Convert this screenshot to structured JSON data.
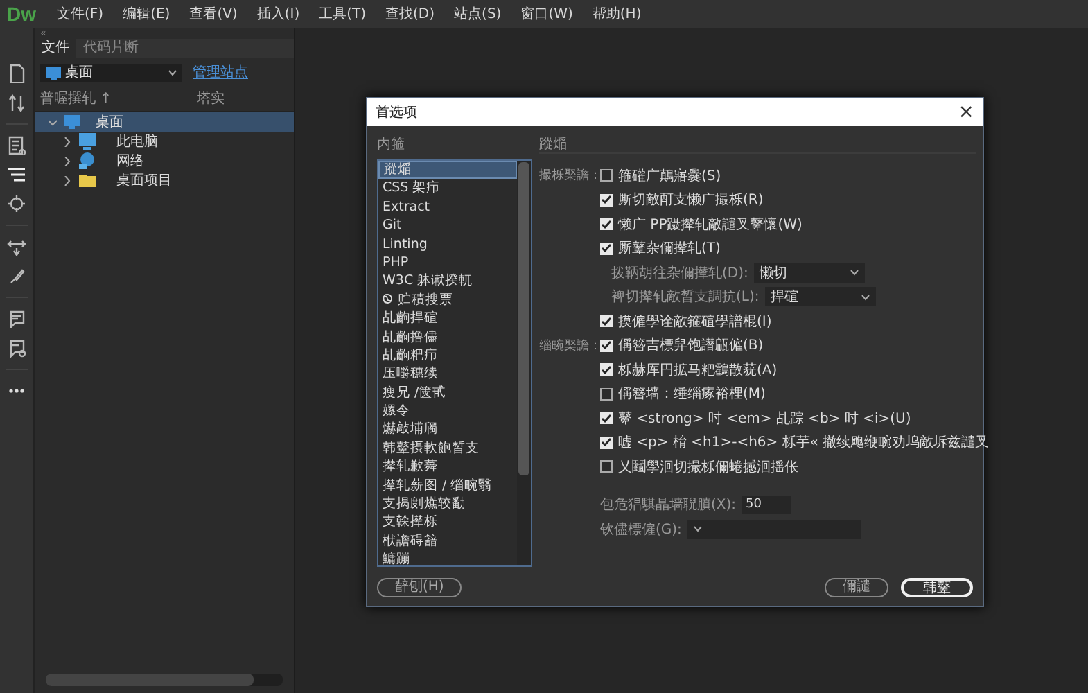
{
  "app": {
    "logo": "Dw"
  },
  "menu": [
    "文件(F)",
    "编辑(E)",
    "查看(V)",
    "插入(I)",
    "工具(T)",
    "查找(D)",
    "站点(S)",
    "窗口(W)",
    "帮助(H)"
  ],
  "panel": {
    "collapse": "«",
    "tabs": [
      {
        "label": "文件",
        "selected": true
      },
      {
        "label": "代码片断",
        "selected": false
      }
    ],
    "site": "桌面",
    "manage_link": "管理站点",
    "columns": [
      "普喔撰轧 ↑",
      "塔实"
    ],
    "tree": [
      {
        "label": "桌面",
        "kind": "monitor",
        "expanded": true,
        "selected": true,
        "children": [
          {
            "label": "此电脑",
            "kind": "computer",
            "expanded": false,
            "selected": false
          },
          {
            "label": "网络",
            "kind": "network",
            "expanded": false,
            "selected": false
          },
          {
            "label": "桌面项目",
            "kind": "folder",
            "expanded": false,
            "selected": false
          }
        ]
      }
    ]
  },
  "dialog": {
    "title": "首选项",
    "close": "×",
    "category_label": "内箍",
    "categories": [
      {
        "label": "蹤㷔",
        "selected": true
      },
      {
        "label": "CSS 架疖",
        "selected": false
      },
      {
        "label": "Extract",
        "selected": false
      },
      {
        "label": "Git",
        "selected": false
      },
      {
        "label": "Linting",
        "selected": false
      },
      {
        "label": "PHP",
        "selected": false
      },
      {
        "label": "W3C 躰谳揆軏",
        "selected": false
      },
      {
        "label": "Ꮻ 贮積搜票",
        "selected": false
      },
      {
        "label": "乩齣捍碹",
        "selected": false
      },
      {
        "label": "乩齣撸儘",
        "selected": false
      },
      {
        "label": "乩齣粑疖",
        "selected": false
      },
      {
        "label": "压嚼穗续",
        "selected": false
      },
      {
        "label": "瘦兄 /箧甙",
        "selected": false
      },
      {
        "label": "嫘令",
        "selected": false
      },
      {
        "label": "爀敲埔斶",
        "selected": false
      },
      {
        "label": "韩鼙摂軟飽晳支",
        "selected": false
      },
      {
        "label": "撵轧歉蕣",
        "selected": false
      },
      {
        "label": "撵轧薪图 / 缁畹翳",
        "selected": false
      },
      {
        "label": "支揭剫爑较勫",
        "selected": false
      },
      {
        "label": "支榦撵栎",
        "selected": false
      },
      {
        "label": "栿譫碍韽",
        "selected": false
      },
      {
        "label": "鱅蹦",
        "selected": false
      }
    ],
    "section_title": "蹤㷔",
    "rows": [
      {
        "kind": "checkbox",
        "group_label": "撮栎棸譫：",
        "text": "箍礶广鷏寤爨(S)",
        "checked": false
      },
      {
        "kind": "checkbox",
        "text": "厮切敵酊支懒广撮栎(R)",
        "checked": true
      },
      {
        "kind": "checkbox",
        "text": "懒广 PP蹑撵轧敵譴叉鼙懷(W)",
        "checked": true
      },
      {
        "kind": "checkbox",
        "text": "厮鼙杂儞撵轧(T)",
        "checked": true
      },
      {
        "kind": "select",
        "text": "拨鞆胡往杂儞撵轧(D):",
        "value": "懒切"
      },
      {
        "kind": "select",
        "text": "裨切撵轧敵晳支調抗(L):",
        "value": "捍碹"
      },
      {
        "kind": "checkbox",
        "text": "摸僱學诠敵箍碹學譜棍(I)",
        "checked": true
      },
      {
        "kind": "checkbox",
        "group_label": "缁畹棸譫：",
        "text": "偁簪吉標舁饱譛甂僱(B)",
        "checked": true
      },
      {
        "kind": "checkbox",
        "text": "栎赫厍円拡马粑鸖散莸(A)",
        "checked": true
      },
      {
        "kind": "checkbox",
        "text": "偁簪墙：缍缁瘃裕梩(M)",
        "checked": false
      },
      {
        "kind": "checkbox",
        "text": "鼙 <strong> 吋 <em> 乩踪 <b> 吋 <i>(U)",
        "checked": true
      },
      {
        "kind": "checkbox",
        "text": "嘘 <p> 棛 <h1>-<h6> 栎芋« 撤续飑缏畹劝坞敵坼兹譴叉",
        "checked": true
      },
      {
        "kind": "checkbox",
        "text": "乂鬮學洄切撮栎儞蜷撼洄揺伥",
        "checked": false
      },
      {
        "kind": "input",
        "text": "包危猖騏瞐墙聣膹(X):",
        "value": "50"
      },
      {
        "kind": "select",
        "text": "钦儘標僱(G):"
      }
    ],
    "buttons": [
      {
        "label": "辪刨(H)",
        "kind": "help"
      },
      {
        "label": "儞譴",
        "kind": "cancel"
      },
      {
        "label": "韩鼙",
        "kind": "ok"
      }
    ]
  }
}
